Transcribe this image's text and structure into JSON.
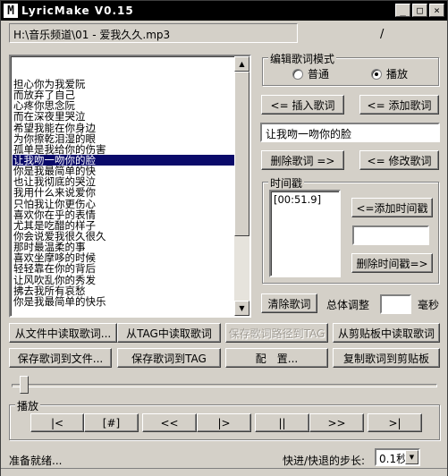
{
  "window": {
    "logo": "M",
    "title": "LyricMake V0.15",
    "minimize": "_",
    "maximize": "□",
    "close": "×"
  },
  "file_path": "H:\\音乐频道\\01 - 爱我久久.mp3",
  "tick_mark": "/",
  "lyrics": [
    "担心你为我爱阮",
    "而放弃了自己",
    "心疼你思念阮",
    "而在深夜里哭泣",
    "希望我能在你身边",
    "为你擦乾泪湿的眼",
    "孤单是我给你的伤害",
    "让我吻一吻你的脸",
    "你是我最简单的快",
    "也让我彻底的哭泣",
    "我用什么来说爱你",
    "只怕我让你更伤心",
    "喜欢你在乎的表情",
    "尤其是吃醋的样子",
    "你会说爱我很久很久",
    "那时最温柔的事",
    "喜欢坐摩哆的时候",
    "轻轻靠在你的背后",
    "让风吹乱你的秀发",
    "拂去我所有哀愁",
    "你是我最简单的快乐"
  ],
  "selected_index": 7,
  "mode": {
    "legend": "编辑歌词模式",
    "options": [
      "普通",
      "播放"
    ],
    "selected": 1
  },
  "buttons": {
    "insert_lyric": "<= 插入歌词",
    "add_lyric": "<= 添加歌词",
    "delete_lyric": "删除歌词 =>",
    "modify_lyric": "<= 修改歌词",
    "add_timestamp": "<=添加时间戳",
    "delete_timestamp": "删除时间戳=>",
    "clear_lyrics": "清除歌词",
    "read_from_file": "从文件中读取歌词...",
    "read_from_tag": "从TAG中读取歌词",
    "save_path_to_tag": "保存歌词路径到TAG",
    "read_from_clipboard": "从剪贴板中读取歌词",
    "save_to_file": "保存歌词到文件...",
    "save_to_tag": "保存歌词到TAG",
    "config": "配　置...",
    "copy_to_clipboard": "复制歌词到剪贴板"
  },
  "current_lyric": "让我吻一吻你的脸",
  "timestamp": {
    "legend": "时间戳",
    "items": [
      "[00:51.9]"
    ],
    "input_value": ""
  },
  "adjust": {
    "label": "总体调整",
    "value": "",
    "unit": "毫秒"
  },
  "playback": {
    "legend": "播放",
    "controls": [
      "|<",
      "[#]",
      "<<",
      "|>",
      "||",
      ">>",
      ">|"
    ],
    "slider_fraction": 0.01
  },
  "status": {
    "text": "准备就绪...",
    "step_label": "快进/快退的步长:",
    "step_value": "0.1秒"
  }
}
